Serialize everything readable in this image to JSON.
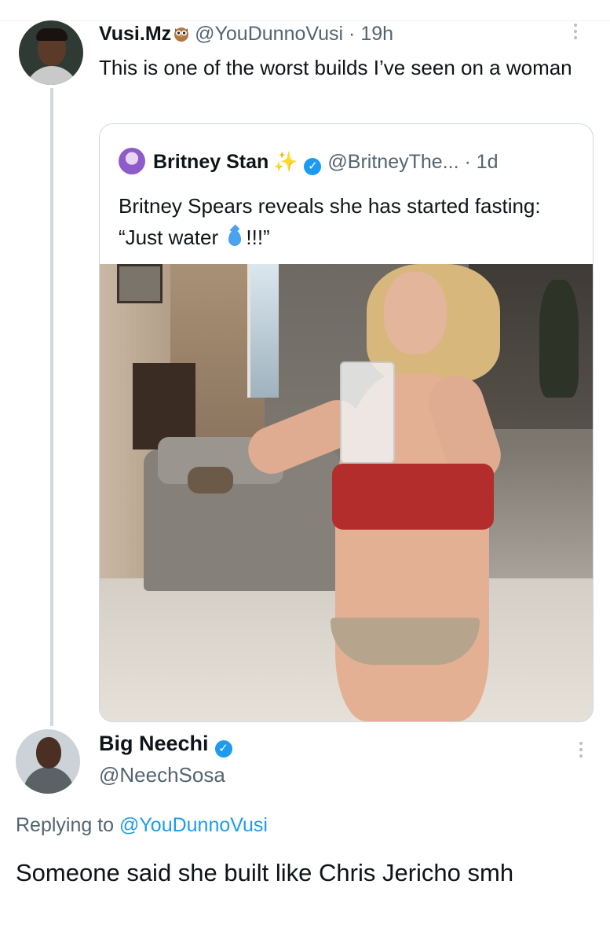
{
  "tweet": {
    "author_name": "Vusi.Mz",
    "author_icon": "owl-emoji-icon",
    "handle": "@YouDunnoVusi",
    "separator": "·",
    "time": "19h",
    "text": "This is one of the worst builds I’ve seen on a woman"
  },
  "quote": {
    "author_name": "Britney Stan",
    "handle": "@BritneyThe...",
    "separator": "·",
    "time": "1d",
    "text_before": "Britney Spears reveals she has started fasting: “Just water",
    "text_after": "!!!”",
    "emoji_icon": "droplet-icon",
    "image": "photo-woman-drinking-water"
  },
  "reply": {
    "author_name": "Big Neechi",
    "handle": "@NeechSosa",
    "replying_to_label": "Replying to",
    "replying_to_handle": "@YouDunnoVusi",
    "text": "Someone said she built like Chris Jericho smh"
  },
  "colors": {
    "accent": "#1d9bf0",
    "muted_text": "#536471",
    "primary_text": "#0f1419",
    "border": "#cfd9de"
  }
}
